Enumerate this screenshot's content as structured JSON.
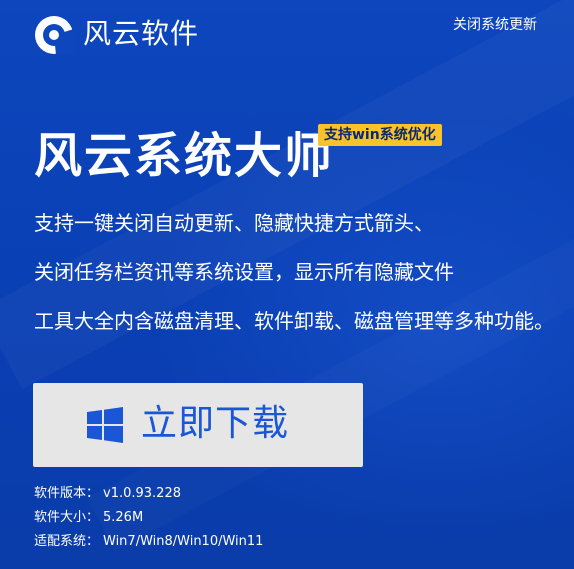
{
  "header": {
    "brand_name": "风云软件",
    "top_link": "关闭系统更新"
  },
  "hero": {
    "title": "风云系统大师",
    "tag": "支持win系统优化",
    "description_lines": [
      "支持一键关闭自动更新、隐藏快捷方式箭头、",
      "关闭任务栏资讯等系统设置，显示所有隐藏文件",
      "工具大全内含磁盘清理、软件卸载、磁盘管理等多种功能。"
    ]
  },
  "download": {
    "label": "立即下载",
    "icon": "windows-icon"
  },
  "info": {
    "rows": [
      {
        "key": "软件版本：",
        "value": "v1.0.93.228"
      },
      {
        "key": "软件大小：",
        "value": "5.26M"
      },
      {
        "key": "适配系统：",
        "value": "Win7/Win8/Win10/Win11"
      }
    ]
  },
  "colors": {
    "background": "#0d46bd",
    "tag_background": "#fac22b",
    "button_background": "#e6e6e6",
    "button_text": "#1a56d6",
    "text": "#ffffff"
  }
}
